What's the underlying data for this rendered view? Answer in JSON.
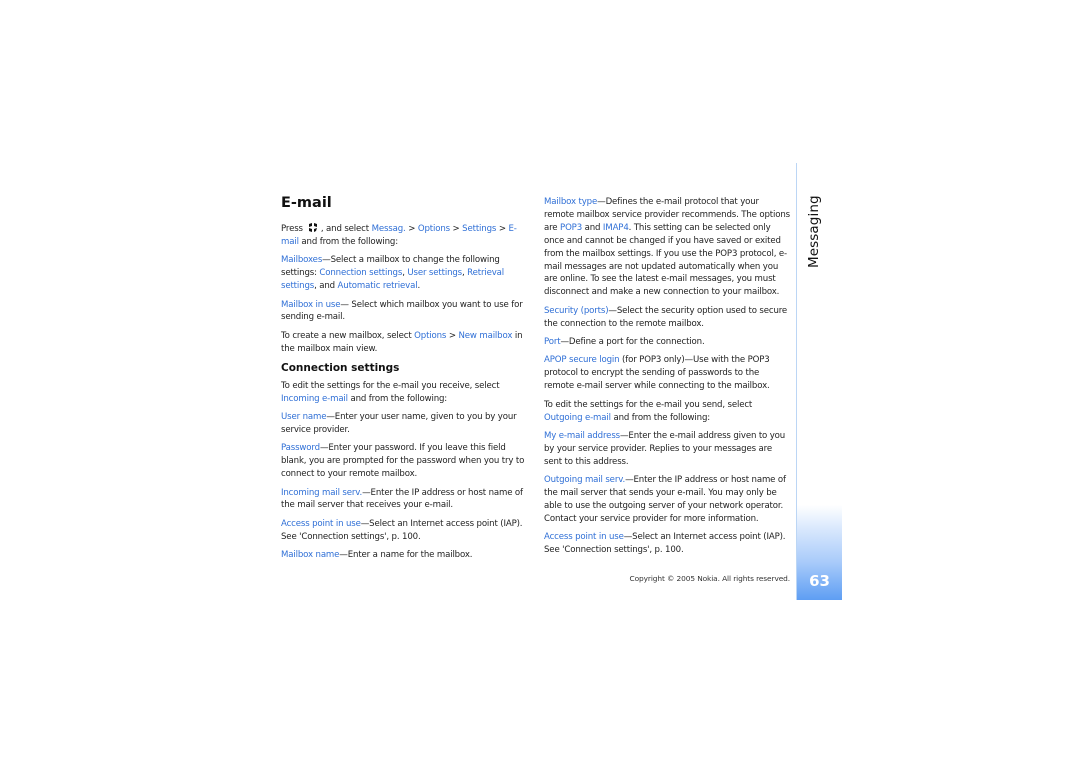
{
  "section": "Messaging",
  "page_number": "63",
  "copyright": "Copyright © 2005 Nokia. All rights reserved.",
  "colors": {
    "link": "#2f6fd6",
    "accent_gradient_end": "#5e9ef3",
    "side_line": "#bcd6f5"
  },
  "left": {
    "title": "E-mail",
    "intro": {
      "press": "Press",
      "icon": "menu-key-icon",
      "t1": ", and select ",
      "l1": "Messag.",
      "s1": " > ",
      "l2": "Options",
      "s2": " > ",
      "l3": "Settings",
      "s3": " > ",
      "l4": "E-mail",
      "t2": " and from the following:"
    },
    "mailboxes": {
      "term": "Mailboxes",
      "t1": "—Select a mailbox to change the following settings: ",
      "l1": "Connection settings",
      "c1": ", ",
      "l2": "User settings",
      "c2": ", ",
      "l3": "Retrieval settings",
      "c3": ", and ",
      "l4": "Automatic retrieval",
      "end": "."
    },
    "mailbox_in_use": {
      "term": "Mailbox in use",
      "text": "— Select which mailbox you want to use for sending e-mail."
    },
    "create": {
      "t1": "To create a new mailbox, select ",
      "l1": "Options",
      "s1": " > ",
      "l2": "New mailbox",
      "t2": " in the mailbox main view."
    },
    "subtitle": "Connection settings",
    "incoming_intro": {
      "t1": "To edit the settings for the e-mail you receive, select ",
      "l1": "Incoming e-mail",
      "t2": " and from the following:"
    },
    "items": [
      {
        "term": "User name",
        "text": "—Enter your user name, given to you by your service provider."
      },
      {
        "term": "Password",
        "text": "—Enter your password. If you leave this field blank, you are prompted for the password when you try to connect to your remote mailbox."
      },
      {
        "term": "Incoming mail serv.",
        "text": "—Enter the IP address or host name of the mail server that receives your e-mail."
      },
      {
        "term": "Access point in use",
        "text": "—Select an Internet access point (IAP). See 'Connection settings', p. 100."
      },
      {
        "term": "Mailbox name",
        "text": "—Enter a name for the mailbox."
      }
    ]
  },
  "right": {
    "mailbox_type": {
      "term": "Mailbox type",
      "t1": "—Defines the e-mail protocol that your remote mailbox service provider recommends. The options are ",
      "l1": "POP3",
      "t2": " and ",
      "l2": "IMAP4",
      "t3": ". This setting can be selected only once and cannot be changed if you have saved or exited from the mailbox settings. If you use the POP3 protocol, e-mail messages are not updated automatically when you are online. To see the latest e-mail messages, you must disconnect and make a new connection to your mailbox."
    },
    "security": {
      "term": "Security (ports)",
      "text": "—Select the security option used to secure the connection to the remote mailbox."
    },
    "port": {
      "term": "Port",
      "text": "—Define a port for the connection."
    },
    "apop": {
      "term": "APOP secure login",
      "text": " (for POP3 only)—Use with the POP3 protocol to encrypt the sending of passwords to the remote e-mail server while connecting to the mailbox."
    },
    "outgoing_intro": {
      "t1": "To edit the settings for the e-mail you send, select ",
      "l1": "Outgoing e-mail",
      "t2": " and from the following:"
    },
    "items": [
      {
        "term": "My e-mail address",
        "text": "—Enter the e-mail address given to you by your service provider. Replies to your messages are sent to this address."
      },
      {
        "term": "Outgoing mail serv.",
        "text": "—Enter the IP address or host name of the mail server that sends your e-mail. You may only be able to use the outgoing server of your network operator. Contact your service provider for more information."
      },
      {
        "term": "Access point in use",
        "text": "—Select an Internet access point (IAP). See 'Connection settings', p. 100."
      }
    ]
  }
}
